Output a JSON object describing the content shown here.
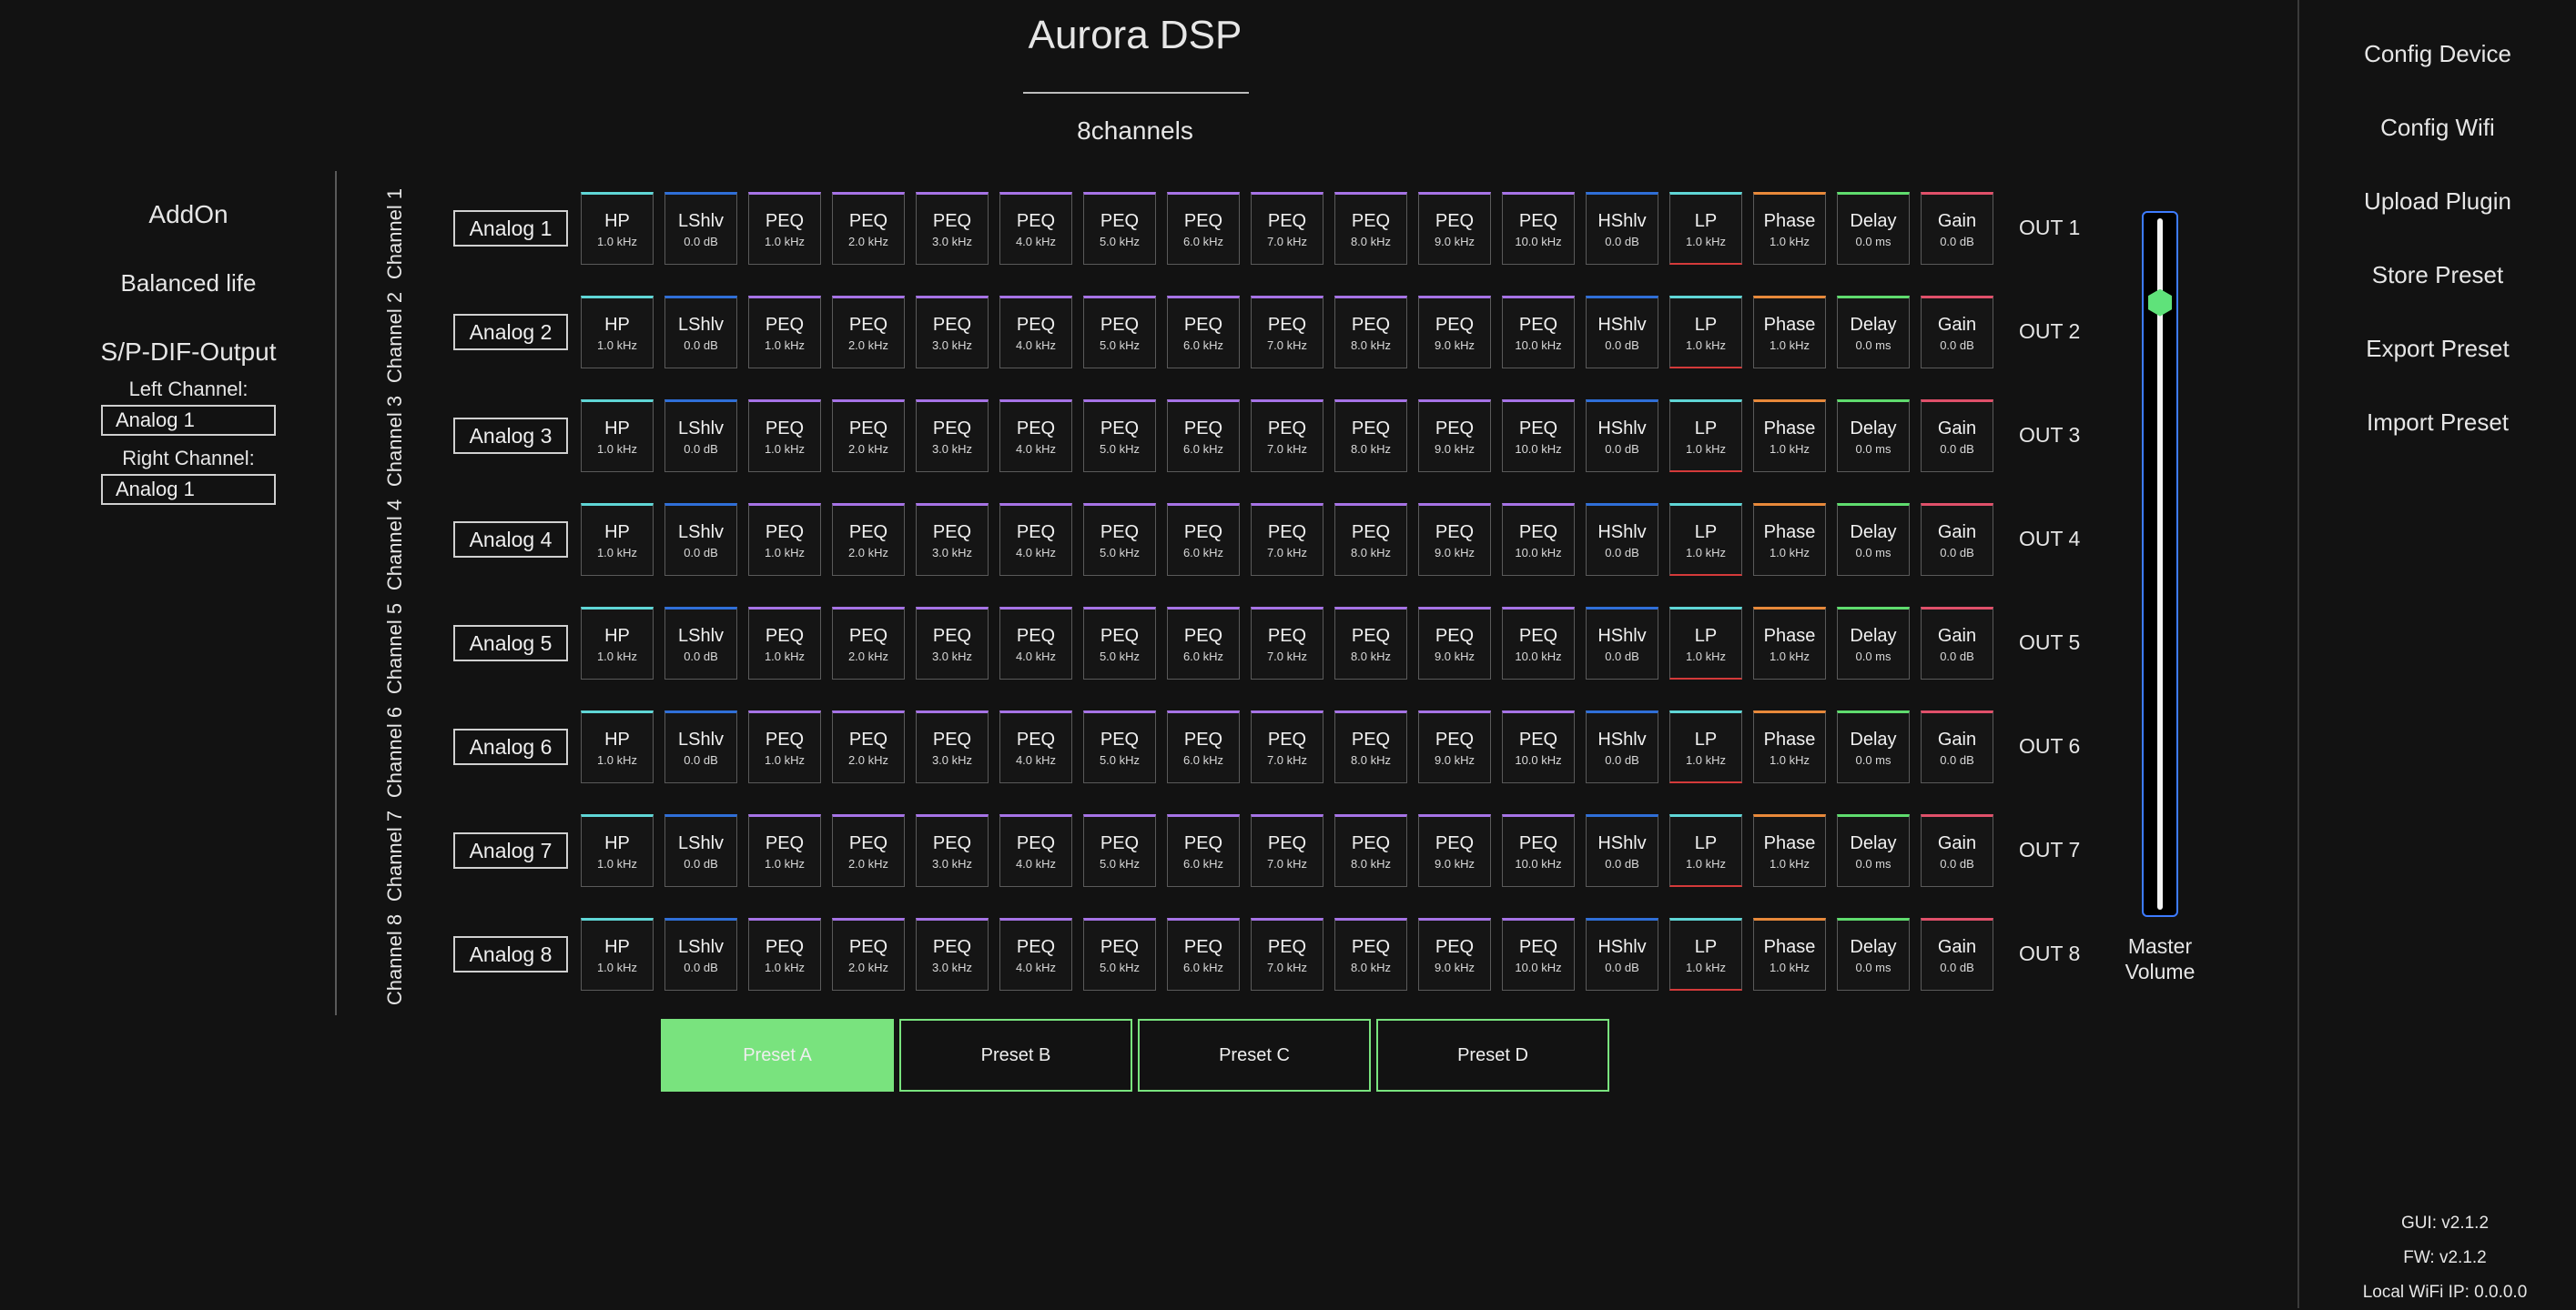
{
  "header": {
    "title": "Aurora DSP",
    "subtitle": "8channels"
  },
  "left_panel": {
    "addon": "AddOn",
    "balanced": "Balanced life",
    "spdif_title": "S/P-DIF-Output",
    "left_label": "Left Channel:",
    "left_value": "Analog 1",
    "right_label": "Right Channel:",
    "right_value": "Analog 1"
  },
  "channels": [
    {
      "label": "Channel 1",
      "input": "Analog 1",
      "output": "OUT 1"
    },
    {
      "label": "Channel 2",
      "input": "Analog 2",
      "output": "OUT 2"
    },
    {
      "label": "Channel 3",
      "input": "Analog 3",
      "output": "OUT 3"
    },
    {
      "label": "Channel 4",
      "input": "Analog 4",
      "output": "OUT 4"
    },
    {
      "label": "Channel 5",
      "input": "Analog 5",
      "output": "OUT 5"
    },
    {
      "label": "Channel 6",
      "input": "Analog 6",
      "output": "OUT 6"
    },
    {
      "label": "Channel 7",
      "input": "Analog 7",
      "output": "OUT 7"
    },
    {
      "label": "Channel 8",
      "input": "Analog 8",
      "output": "OUT 8"
    }
  ],
  "blocks": [
    {
      "name": "HP",
      "value": "1.0 kHz",
      "color": "#5fd6d6",
      "bottom": ""
    },
    {
      "name": "LShlv",
      "value": "0.0 dB",
      "color": "#2f6fd8",
      "bottom": ""
    },
    {
      "name": "PEQ",
      "value": "1.0 kHz",
      "color": "#a673e6",
      "bottom": ""
    },
    {
      "name": "PEQ",
      "value": "2.0 kHz",
      "color": "#a673e6",
      "bottom": ""
    },
    {
      "name": "PEQ",
      "value": "3.0 kHz",
      "color": "#a673e6",
      "bottom": ""
    },
    {
      "name": "PEQ",
      "value": "4.0 kHz",
      "color": "#a673e6",
      "bottom": ""
    },
    {
      "name": "PEQ",
      "value": "5.0 kHz",
      "color": "#a673e6",
      "bottom": ""
    },
    {
      "name": "PEQ",
      "value": "6.0 kHz",
      "color": "#a673e6",
      "bottom": ""
    },
    {
      "name": "PEQ",
      "value": "7.0 kHz",
      "color": "#a673e6",
      "bottom": ""
    },
    {
      "name": "PEQ",
      "value": "8.0 kHz",
      "color": "#a673e6",
      "bottom": ""
    },
    {
      "name": "PEQ",
      "value": "9.0 kHz",
      "color": "#a673e6",
      "bottom": ""
    },
    {
      "name": "PEQ",
      "value": "10.0 kHz",
      "color": "#a673e6",
      "bottom": ""
    },
    {
      "name": "HShlv",
      "value": "0.0 dB",
      "color": "#2f6fd8",
      "bottom": ""
    },
    {
      "name": "LP",
      "value": "1.0 kHz",
      "color": "#5fd6d6",
      "bottom": "#d43a3a"
    },
    {
      "name": "Phase",
      "value": "1.0 kHz",
      "color": "#e8893a",
      "bottom": ""
    },
    {
      "name": "Delay",
      "value": "0.0 ms",
      "color": "#5fdc6e",
      "bottom": ""
    },
    {
      "name": "Gain",
      "value": "0.0 dB",
      "color": "#e0506a",
      "bottom": ""
    }
  ],
  "master_volume": {
    "label_line1": "Master",
    "label_line2": "Volume",
    "level": 0.89
  },
  "presets": [
    {
      "label": "Preset A",
      "active": true
    },
    {
      "label": "Preset B",
      "active": false
    },
    {
      "label": "Preset C",
      "active": false
    },
    {
      "label": "Preset D",
      "active": false
    }
  ],
  "menu": [
    "Config Device",
    "Config Wifi",
    "Upload Plugin",
    "Store Preset",
    "Export Preset",
    "Import Preset"
  ],
  "footer": {
    "gui": "GUI: v2.1.2",
    "fw": "FW: v2.1.2",
    "ip": "Local WiFi IP: 0.0.0.0"
  }
}
